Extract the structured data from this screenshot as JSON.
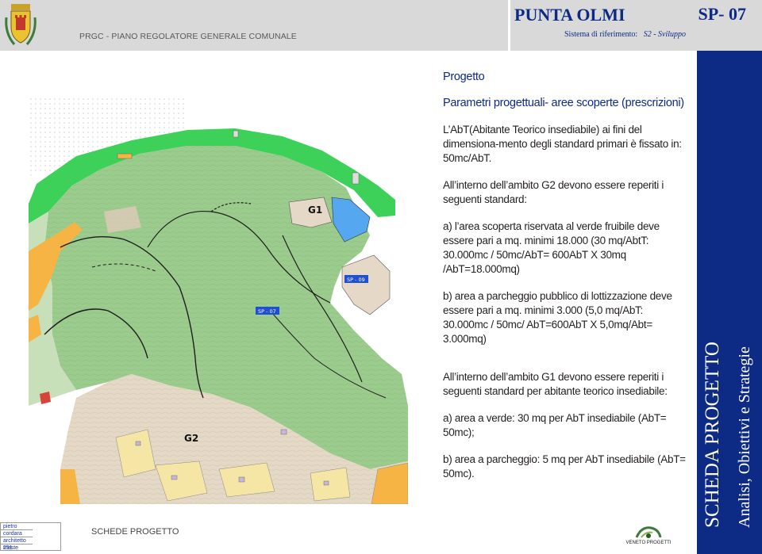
{
  "header": {
    "subtitle": "PRGC - PIANO REGOLATORE GENERALE COMUNALE",
    "title": "PUNTA OLMI",
    "code": "SP- 07",
    "ref_label": "Sistema di riferimento:",
    "ref_value": "S2 - Sviluppo"
  },
  "side_band": {
    "line1": "SCHEDA PROGETTO",
    "line2": "Analisi, Obiettivi e Strategie"
  },
  "map": {
    "labels": {
      "g1": "G1",
      "g2": "G2",
      "sp09": "SP - 09",
      "sp07": "SP - 07"
    }
  },
  "content": {
    "section": "Progetto",
    "subsection": "Parametri progettuali- aree scoperte (prescrizioni)",
    "paragraphs": [
      "L’AbT(Abitante Teorico insediabile) ai fini del dimensiona-mento degli standard primari è fissato in: 50mc/AbT.",
      "All’interno dell’ambito G2 devono essere reperiti i seguenti standard:",
      "a) l’area scoperta riservata al verde fruibile deve essere pari a mq. minimi 18.000 (30 mq/AbtT: 30.000mc / 50mc/AbT= 600AbT X 30mq /AbT=18.000mq)",
      "b) area a parcheggio pubblico di lottizzazione deve essere pari a mq. minimi 3.000 (5,0 mq/AbT: 30.000mc / 50mc/ AbT=600AbT X 5,0mq/Abt= 3.000mq)",
      "All’interno dell’ambito G1 devono essere reperiti i seguenti standard per abitante teorico insediabile:",
      "a) area a verde: 30 mq per AbT insediabile (AbT= 50mc);",
      "b) area a parcheggio: 5 mq per AbT insediabile (AbT= 50mc)."
    ]
  },
  "footer": {
    "section_label": "SCHEDE PROGETTO",
    "author": [
      "pietro",
      "cordara",
      "architetto 251",
      "trieste"
    ],
    "logo_text": "VENETO PROGETTI"
  },
  "colors": {
    "brand_blue": "#0d2a85",
    "header_gray": "#d9d9d9",
    "map_green": "#9ccb8e",
    "map_bright_green": "#3dd159",
    "map_blue": "#55a8f0",
    "map_orange": "#f6b444",
    "map_beige": "#e6d8c6"
  }
}
